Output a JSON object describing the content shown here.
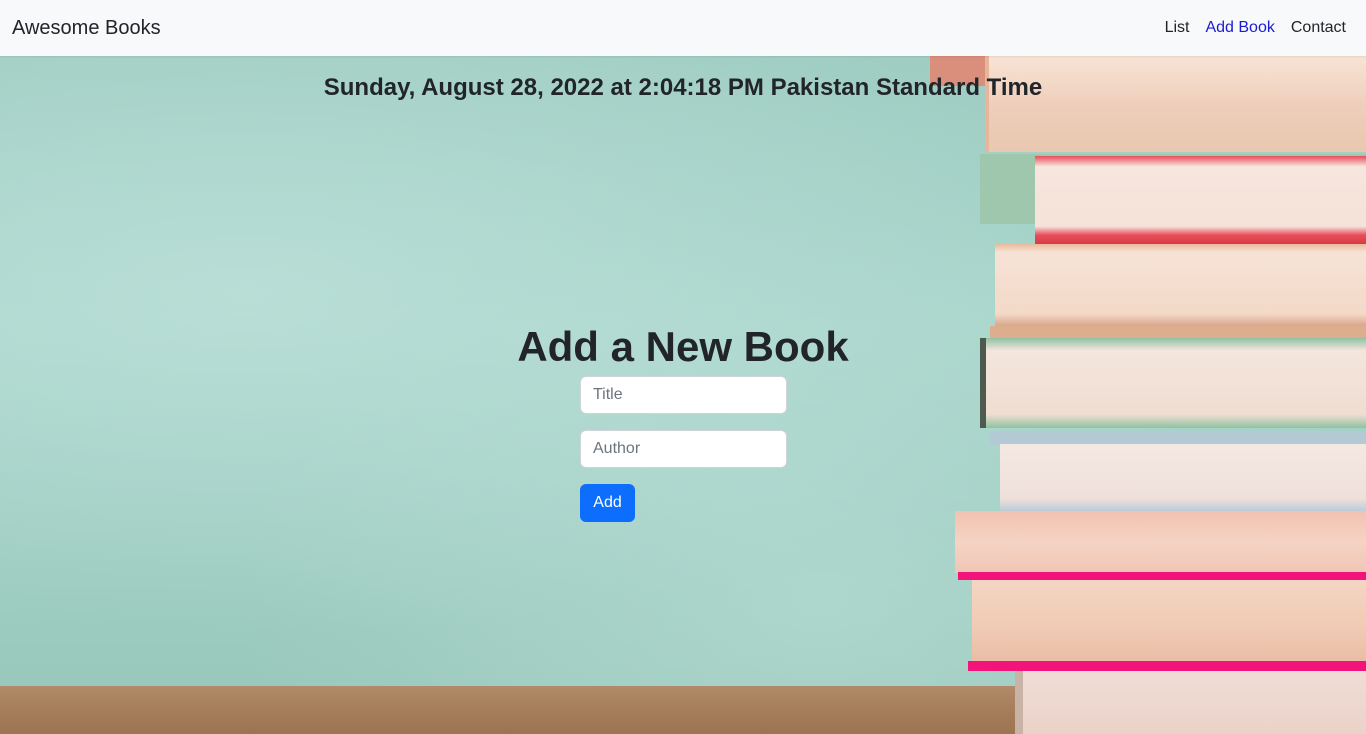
{
  "navbar": {
    "brand": "Awesome Books",
    "links": [
      {
        "label": "List"
      },
      {
        "label": "Add Book"
      },
      {
        "label": "Contact"
      }
    ],
    "active_color": "#1b1bd6"
  },
  "datetime": "Sunday, August 28, 2022 at 2:04:18 PM Pakistan Standard Time",
  "form": {
    "heading": "Add a New Book",
    "title_placeholder": "Title",
    "author_placeholder": "Author",
    "submit_label": "Add",
    "submit_color": "#0d6efd"
  }
}
